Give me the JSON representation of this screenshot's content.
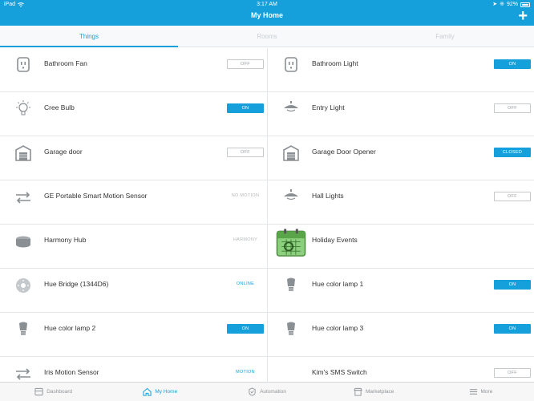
{
  "status": {
    "device": "iPad",
    "time": "3:17 AM",
    "battery": "92%"
  },
  "header": {
    "title": "My Home",
    "add": "+"
  },
  "tabs": [
    {
      "label": "Things"
    },
    {
      "label": "Rooms"
    },
    {
      "label": "Family"
    }
  ],
  "things": [
    {
      "name": "Bathroom Fan",
      "state": "OFF",
      "style": "off",
      "icon": "outlet-icon"
    },
    {
      "name": "Bathroom Light",
      "state": "ON",
      "style": "on",
      "icon": "outlet-icon"
    },
    {
      "name": "Cree Bulb",
      "state": "ON",
      "style": "on",
      "icon": "lightbulb-icon"
    },
    {
      "name": "Entry Light",
      "state": "OFF",
      "style": "off",
      "icon": "ceiling-light-icon"
    },
    {
      "name": "Garage door",
      "state": "OFF",
      "style": "off",
      "icon": "garage-icon"
    },
    {
      "name": "Garage Door Opener",
      "state": "CLOSED",
      "style": "on",
      "icon": "garage-icon"
    },
    {
      "name": "GE Portable Smart Motion Sensor",
      "state": "NO MOTION",
      "style": "text",
      "icon": "motion-arrows-icon"
    },
    {
      "name": "Hall Lights",
      "state": "OFF",
      "style": "off",
      "icon": "ceiling-light-icon"
    },
    {
      "name": "Harmony Hub",
      "state": "HARMONY",
      "style": "text",
      "icon": "hub-icon"
    },
    {
      "name": "Holiday Events",
      "state": "",
      "style": "none",
      "icon": "calendar-icon"
    },
    {
      "name": "Hue Bridge (1344D6)",
      "state": "ONLINE",
      "style": "textblue",
      "icon": "bridge-icon"
    },
    {
      "name": "Hue color lamp 1",
      "state": "ON",
      "style": "on",
      "icon": "lamp-bulb-icon"
    },
    {
      "name": "Hue color lamp 2",
      "state": "ON",
      "style": "on",
      "icon": "lamp-bulb-icon"
    },
    {
      "name": "Hue color lamp 3",
      "state": "ON",
      "style": "on",
      "icon": "lamp-bulb-icon"
    },
    {
      "name": "Iris Motion Sensor",
      "state": "MOTION",
      "style": "textblue",
      "icon": "motion-arrows-icon"
    },
    {
      "name": "Kim's SMS Switch",
      "state": "OFF",
      "style": "off",
      "icon": "switch-icon"
    }
  ],
  "nav": [
    {
      "label": "Dashboard",
      "icon": "dashboard-icon"
    },
    {
      "label": "My Home",
      "icon": "home-icon"
    },
    {
      "label": "Automation",
      "icon": "automation-icon"
    },
    {
      "label": "Marketplace",
      "icon": "marketplace-icon"
    },
    {
      "label": "More",
      "icon": "menu-icon"
    }
  ],
  "colors": {
    "accent": "#15a0dc",
    "divider": "#e4e7ea"
  }
}
